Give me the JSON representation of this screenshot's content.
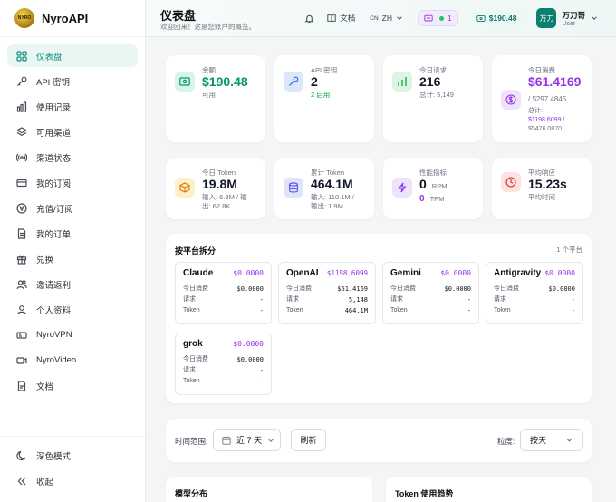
{
  "brand": {
    "name": "NyroAPI",
    "logo_text": "NYRO"
  },
  "sidebar": {
    "items": [
      {
        "label": "仪表盘",
        "icon": "dashboard-icon"
      },
      {
        "label": "API 密钥",
        "icon": "key-icon"
      },
      {
        "label": "使用记录",
        "icon": "bar-chart-icon"
      },
      {
        "label": "可用渠道",
        "icon": "layers-icon"
      },
      {
        "label": "渠道状态",
        "icon": "signal-icon"
      },
      {
        "label": "我的订阅",
        "icon": "card-icon"
      },
      {
        "label": "充值/订阅",
        "icon": "yen-icon"
      },
      {
        "label": "我的订单",
        "icon": "document-icon"
      },
      {
        "label": "兑换",
        "icon": "gift-icon"
      },
      {
        "label": "邀请返利",
        "icon": "users-icon"
      },
      {
        "label": "个人资料",
        "icon": "user-icon"
      },
      {
        "label": "NyroVPN",
        "icon": "vpn-icon"
      },
      {
        "label": "NyroVideo",
        "icon": "video-icon"
      },
      {
        "label": "文档",
        "icon": "file-icon"
      }
    ],
    "dark_mode": "深色模式",
    "collapse": "收起"
  },
  "header": {
    "title": "仪表盘",
    "subtitle": "欢迎回来！这是您账户的概览。",
    "docs": "文档",
    "lang_code": "CN",
    "lang": "ZH",
    "status_count": "1",
    "balance": "$190.48",
    "user_avatar": "万刀",
    "user_name": "万刀哥",
    "user_role": "User"
  },
  "stats_top": [
    {
      "label": "余额",
      "value": "$190.48",
      "sub": "可用",
      "color": "#10b981"
    },
    {
      "label": "API 密钥",
      "value": "2",
      "sub": "2 启用",
      "color": "#3b82f6"
    },
    {
      "label": "今日请求",
      "value": "216",
      "sub": "总计: 5,149",
      "color": "#22c55e"
    },
    {
      "label": "今日消费",
      "value": "$61.4169",
      "sub1": "/ $297.4845",
      "sub2_label": "总计:",
      "sub2_a": "$1198.6099",
      "sub2_b": "$5476.0870",
      "color": "#9333ea"
    }
  ],
  "stats_second": [
    {
      "label": "今日 Token",
      "value": "19.8M",
      "sub1": "输入: 6.3M / 输",
      "sub2": "出: 62.8K"
    },
    {
      "label": "累计 Token",
      "value": "464.1M",
      "sub1": "输入: 110.1M /",
      "sub2": "输出: 1.9M"
    },
    {
      "label": "性能指标",
      "rpm_value": "0",
      "rpm_unit": "RPM",
      "tpm_value": "0",
      "tpm_unit": "TPM"
    },
    {
      "label": "平均响应",
      "value": "15.23s",
      "sub": "平均时间"
    }
  ],
  "platform": {
    "title": "按平台拆分",
    "count": "1 个平台",
    "row_labels": {
      "cost": "今日消费",
      "requests": "请求",
      "token": "Token"
    },
    "cards": [
      {
        "name": "Claude",
        "cost": "$0.0000",
        "today": "$0.0000",
        "requests": "-",
        "token": "-"
      },
      {
        "name": "OpenAI",
        "cost": "$1198.6099",
        "today": "$61.4169",
        "requests": "5,148",
        "token": "464.1M"
      },
      {
        "name": "Gemini",
        "cost": "$0.0000",
        "today": "$0.0000",
        "requests": "-",
        "token": "-"
      },
      {
        "name": "Antigravity",
        "cost": "$0.0000",
        "today": "$0.0000",
        "requests": "-",
        "token": "-"
      },
      {
        "name": "grok",
        "cost": "$0.0000",
        "today": "$0.0000",
        "requests": "-",
        "token": "-"
      }
    ]
  },
  "filters": {
    "time_label": "时间范围:",
    "time_value": "近 7 天",
    "refresh": "刷新",
    "granularity_label": "粒度:",
    "granularity_value": "按天"
  },
  "sections": {
    "model_dist": "模型分布",
    "token_trend": "Token 使用趋势"
  }
}
